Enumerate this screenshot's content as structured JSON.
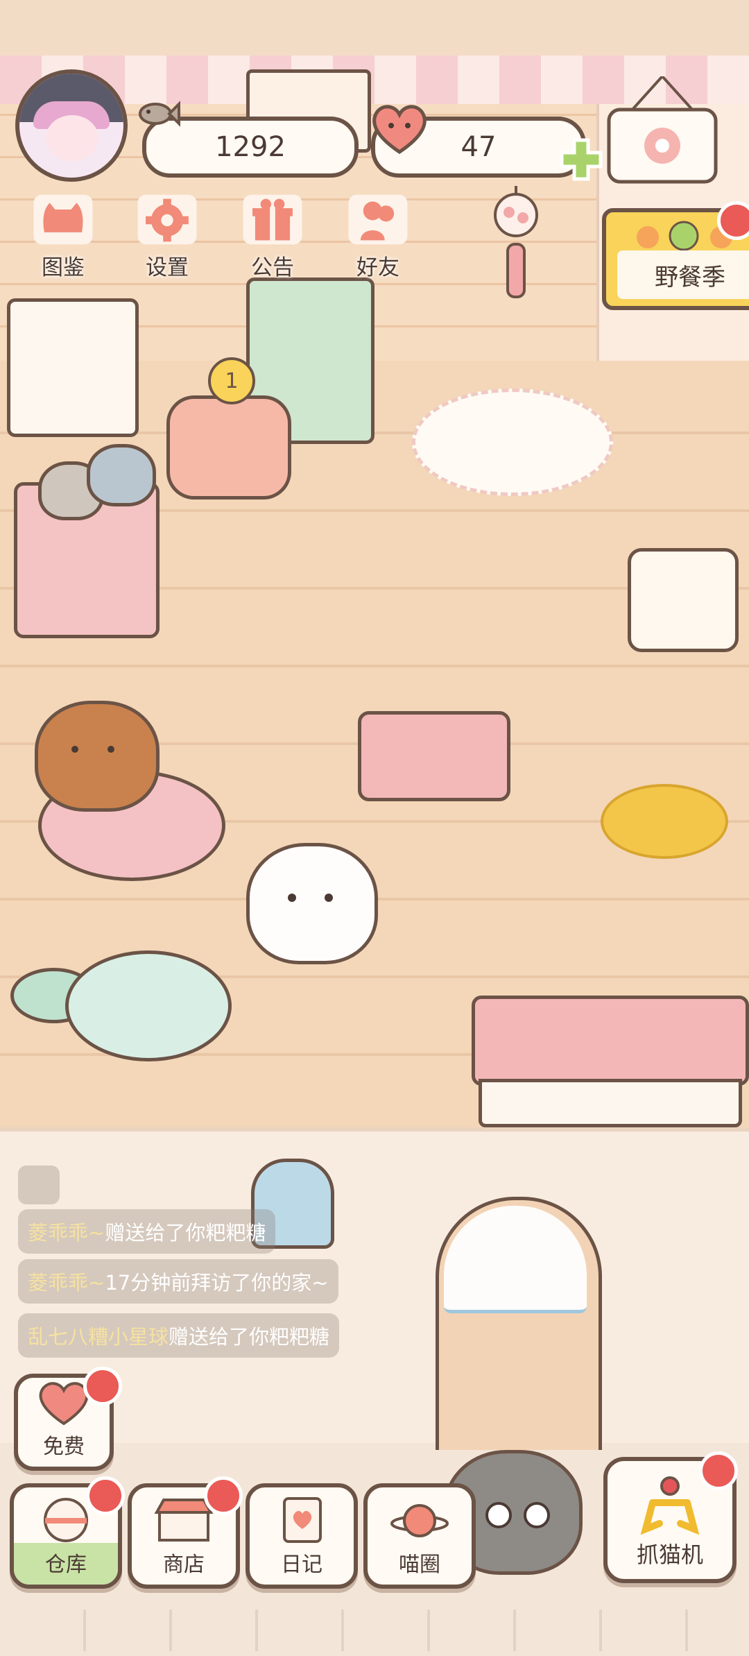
{
  "game": {
    "currency": {
      "fish": "1292",
      "hearts": "47"
    },
    "top_menu": [
      {
        "id": "catalog",
        "label": "图鉴",
        "icon": "cat-head-icon"
      },
      {
        "id": "settings",
        "label": "设置",
        "icon": "gear-icon"
      },
      {
        "id": "announcement",
        "label": "公告",
        "icon": "gift-icon"
      },
      {
        "id": "friends",
        "label": "好友",
        "icon": "friends-icon"
      }
    ],
    "event_button": {
      "label": "野餐季",
      "has_badge": true
    },
    "notifications": [
      {
        "name": "菱乖乖~",
        "text": "赠送给了你粑粑糖"
      },
      {
        "name": "菱乖乖~",
        "text": "17分钟前拜访了你的家~"
      },
      {
        "name": "乱七八糟小星球",
        "text": "赠送给了你粑粑糖"
      }
    ],
    "free_button": {
      "label": "免费",
      "has_badge": true
    },
    "bottom_nav": [
      {
        "id": "warehouse",
        "label": "仓库",
        "has_badge": true
      },
      {
        "id": "shop",
        "label": "商店",
        "has_badge": true
      },
      {
        "id": "diary",
        "label": "日记",
        "has_badge": false
      },
      {
        "id": "cat_circle",
        "label": "喵圈",
        "has_badge": false
      }
    ],
    "claw_machine": {
      "label": "抓猫机",
      "has_badge": true
    },
    "scene_badges": {
      "cake_number": "1"
    },
    "colors": {
      "outline": "#6b5346",
      "badge_red": "#ea5a56",
      "wall": "#f6dcc1",
      "floor": "#f4d7b9",
      "event_yellow": "#f9d35a"
    }
  }
}
